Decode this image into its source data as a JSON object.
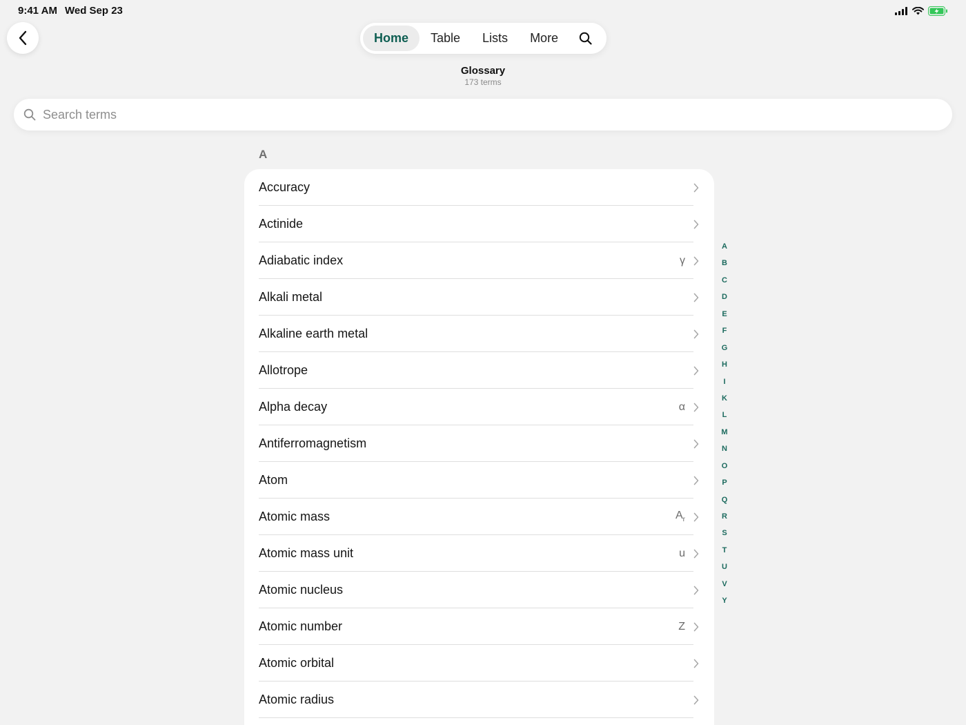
{
  "status_bar": {
    "time": "9:41 AM",
    "date": "Wed Sep 23"
  },
  "tabs": [
    {
      "label": "Home",
      "active": true
    },
    {
      "label": "Table",
      "active": false
    },
    {
      "label": "Lists",
      "active": false
    },
    {
      "label": "More",
      "active": false
    }
  ],
  "header": {
    "title": "Glossary",
    "subtitle": "173 terms"
  },
  "search": {
    "placeholder": "Search terms",
    "value": ""
  },
  "section": {
    "letter": "A",
    "items": [
      {
        "label": "Accuracy",
        "symbol": ""
      },
      {
        "label": "Actinide",
        "symbol": ""
      },
      {
        "label": "Adiabatic index",
        "symbol": "γ"
      },
      {
        "label": "Alkali metal",
        "symbol": ""
      },
      {
        "label": "Alkaline earth metal",
        "symbol": ""
      },
      {
        "label": "Allotrope",
        "symbol": ""
      },
      {
        "label": "Alpha decay",
        "symbol": "α"
      },
      {
        "label": "Antiferromagnetism",
        "symbol": ""
      },
      {
        "label": "Atom",
        "symbol": ""
      },
      {
        "label": "Atomic mass",
        "symbol": "A",
        "symbol_sub": "r"
      },
      {
        "label": "Atomic mass unit",
        "symbol": "u"
      },
      {
        "label": "Atomic nucleus",
        "symbol": ""
      },
      {
        "label": "Atomic number",
        "symbol": "Z"
      },
      {
        "label": "Atomic orbital",
        "symbol": ""
      },
      {
        "label": "Atomic radius",
        "symbol": ""
      },
      {
        "label": "",
        "symbol": ""
      }
    ]
  },
  "index_letters": [
    "A",
    "B",
    "C",
    "D",
    "E",
    "F",
    "G",
    "H",
    "I",
    "K",
    "L",
    "M",
    "N",
    "O",
    "P",
    "Q",
    "R",
    "S",
    "T",
    "U",
    "V",
    "Y"
  ],
  "colors": {
    "accent": "#0e5e52",
    "index": "#1d6b5f",
    "battery": "#34c759"
  }
}
